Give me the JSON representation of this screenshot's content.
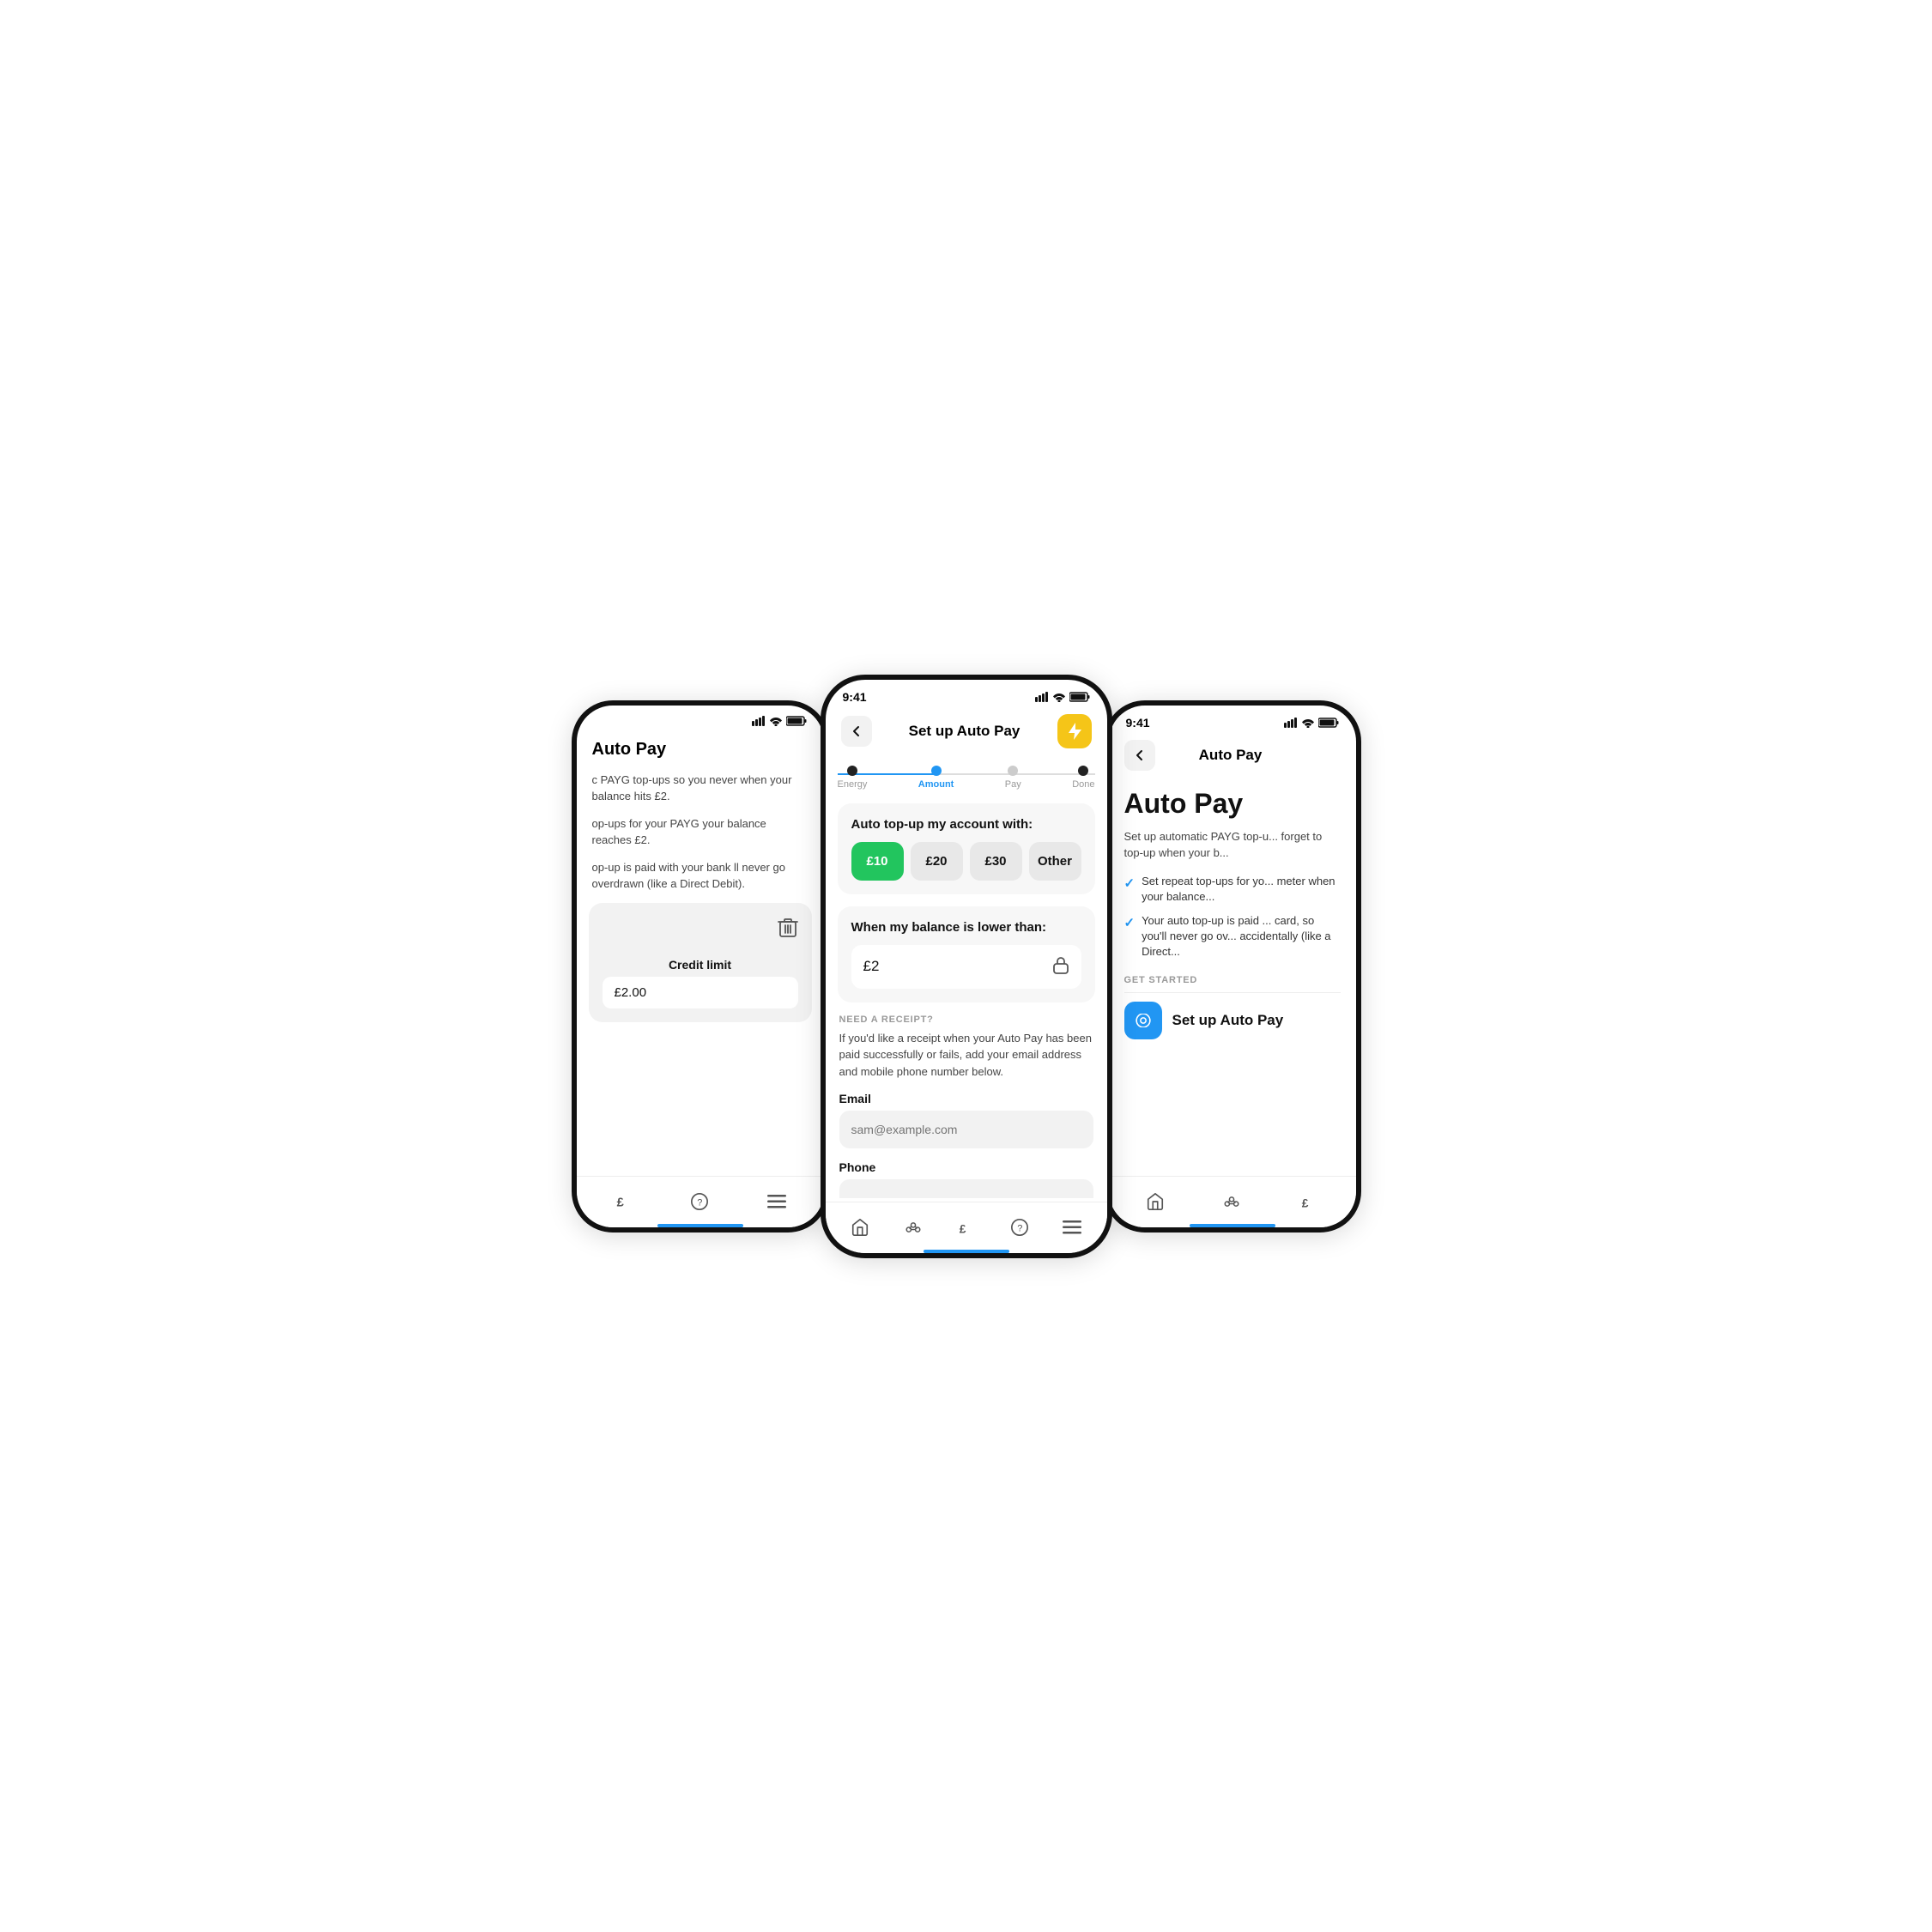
{
  "phones": {
    "left": {
      "title": "Auto Pay",
      "desc1": "c PAYG top-ups so you never when your balance hits £2.",
      "desc2": "op-ups for your PAYG your balance reaches £2.",
      "desc3": "op-up is paid with your bank ll never go overdrawn (like a Direct Debit).",
      "credit_limit_label": "Credit limit",
      "credit_limit_value": "£2.00",
      "nav_items": [
        "£",
        "?",
        "≡"
      ]
    },
    "center": {
      "time": "9:41",
      "header_title": "Set up Auto Pay",
      "steps": [
        {
          "label": "Energy",
          "state": "done"
        },
        {
          "label": "Amount",
          "state": "active"
        },
        {
          "label": "Pay",
          "state": "inactive"
        },
        {
          "label": "Done",
          "state": "inactive"
        }
      ],
      "card1_title": "Auto top-up my account with:",
      "amounts": [
        {
          "label": "£10",
          "selected": true
        },
        {
          "label": "£20",
          "selected": false
        },
        {
          "label": "£30",
          "selected": false
        },
        {
          "label": "Other",
          "selected": false
        }
      ],
      "card2_title": "When my balance is lower than:",
      "balance_value": "£2",
      "receipt_section_label": "NEED A RECEIPT?",
      "receipt_desc": "If you'd like a receipt when your Auto Pay has been paid successfully or fails, add your email address and mobile phone number below.",
      "email_label": "Email",
      "email_placeholder": "sam@example.com",
      "phone_label": "Phone",
      "phone_placeholder": "",
      "nav_items": [
        "🏠",
        "⬡",
        "£",
        "?",
        "≡"
      ]
    },
    "right": {
      "time": "9:41",
      "header_title": "Auto Pay",
      "main_title": "Auto Pay",
      "desc": "Set up automatic PAYG top-u... forget to top-up when your b...",
      "check_items": [
        "Set repeat top-ups for yo... meter when your balance...",
        "Your auto top-up is paid ... card, so you'll never go ov... accidentally (like a Direct..."
      ],
      "get_started_label": "GET STARTED",
      "setup_btn_label": "Set up Auto Pay",
      "nav_items": [
        "🏠",
        "⬡",
        "£"
      ]
    }
  }
}
